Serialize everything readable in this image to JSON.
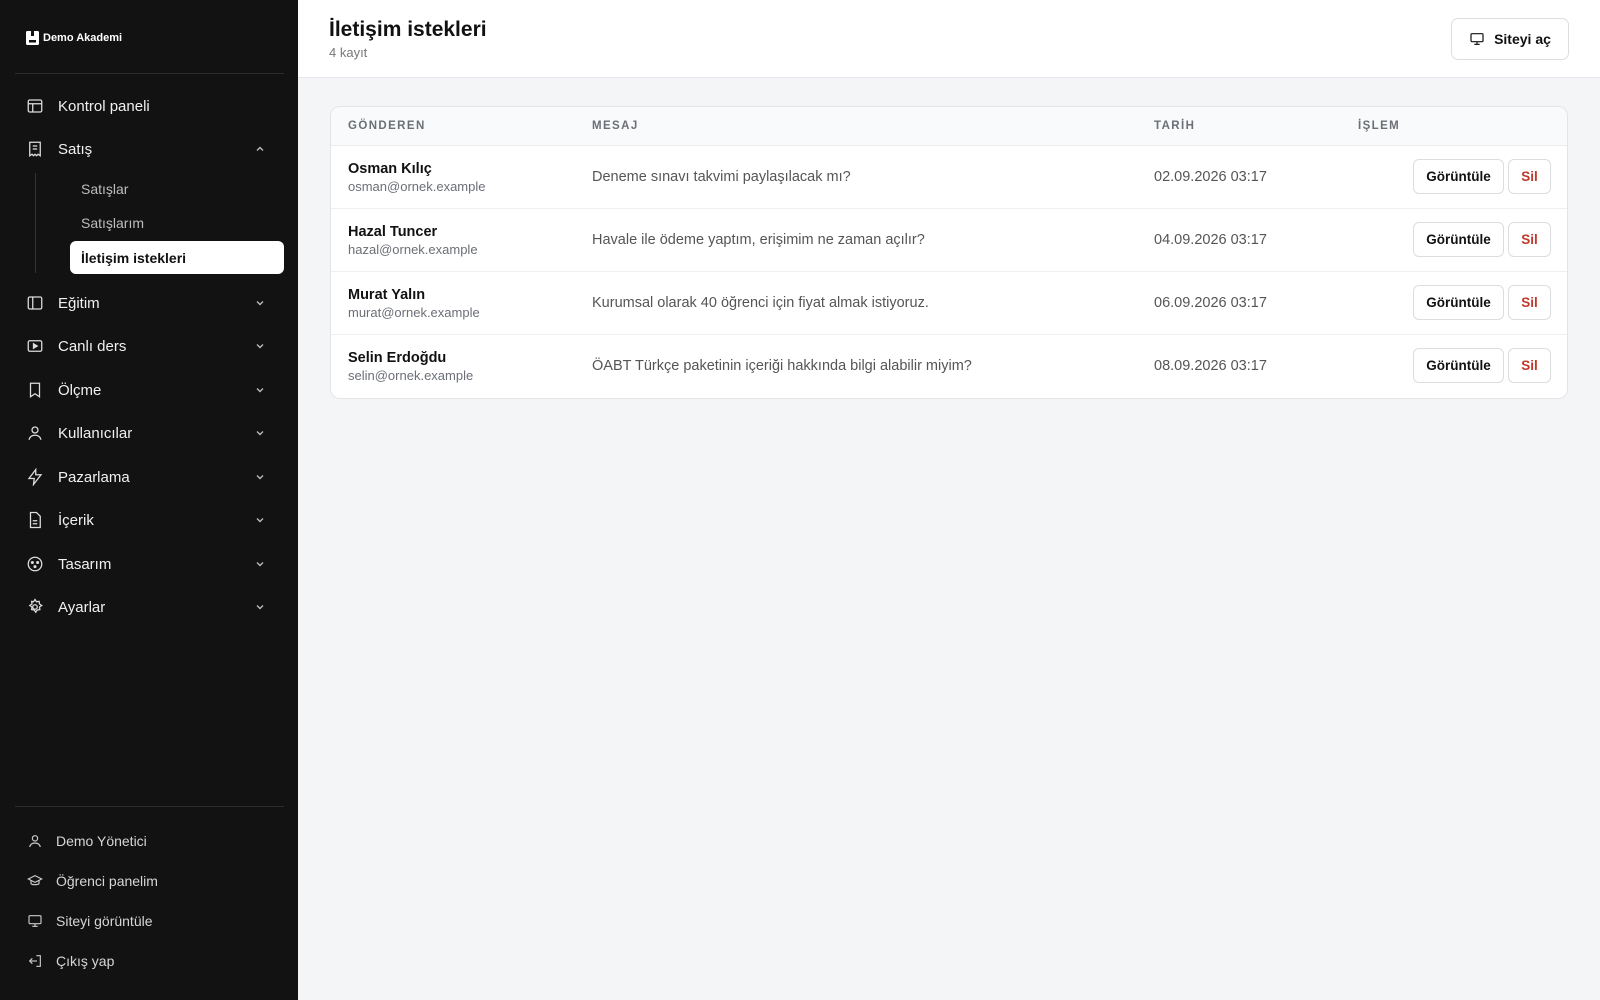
{
  "brand": {
    "name": "Demo Akademi",
    "icon": "brand-logo-icon"
  },
  "sidebar": {
    "items": [
      {
        "label": "Kontrol paneli",
        "icon": "layout-icon"
      },
      {
        "label": "Satış",
        "icon": "receipt-icon",
        "expanded": true
      },
      {
        "label": "Eğitim",
        "icon": "sidebar-book-icon"
      },
      {
        "label": "Canlı ders",
        "icon": "video-play-icon"
      },
      {
        "label": "Ölçme",
        "icon": "bookmark-icon"
      },
      {
        "label": "Kullanıcılar",
        "icon": "user-icon"
      },
      {
        "label": "Pazarlama",
        "icon": "lightning-icon"
      },
      {
        "label": "İçerik",
        "icon": "document-icon"
      },
      {
        "label": "Tasarım",
        "icon": "palette-icon"
      },
      {
        "label": "Ayarlar",
        "icon": "gear-icon"
      }
    ],
    "sales_sub": [
      {
        "label": "Satışlar"
      },
      {
        "label": "Satışlarım"
      },
      {
        "label": "İletişim istekleri",
        "active": true
      }
    ],
    "footer": [
      {
        "label": "Demo Yönetici",
        "icon": "user-icon"
      },
      {
        "label": "Öğrenci panelim",
        "icon": "graduation-cap-icon"
      },
      {
        "label": "Siteyi görüntüle",
        "icon": "monitor-icon"
      },
      {
        "label": "Çıkış yap",
        "icon": "logout-icon"
      }
    ]
  },
  "header": {
    "title": "İletişim istekleri",
    "count": "4 kayıt",
    "open_site_label": "Siteyi aç",
    "open_site_icon": "monitor-icon"
  },
  "table": {
    "columns": [
      "GÖNDEREN",
      "MESAJ",
      "TARİH",
      "İŞLEM"
    ],
    "rows": [
      {
        "name": "Osman Kılıç",
        "email": "osman@ornek.example",
        "message": "Deneme sınavı takvimi paylaşılacak mı?",
        "date": "02.09.2026 03:17",
        "view": "Görüntüle",
        "delete": "Sil"
      },
      {
        "name": "Hazal Tuncer",
        "email": "hazal@ornek.example",
        "message": "Havale ile ödeme yaptım, erişimim ne zaman açılır?",
        "date": "04.09.2026 03:17",
        "view": "Görüntüle",
        "delete": "Sil"
      },
      {
        "name": "Murat Yalın",
        "email": "murat@ornek.example",
        "message": "Kurumsal olarak 40 öğrenci için fiyat almak istiyoruz.",
        "date": "06.09.2026 03:17",
        "view": "Görüntüle",
        "delete": "Sil"
      },
      {
        "name": "Selin Erdoğdu",
        "email": "selin@ornek.example",
        "message": "ÖABT Türkçe paketinin içeriği hakkında bilgi alabilir miyim?",
        "date": "08.09.2026 03:17",
        "view": "Görüntüle",
        "delete": "Sil"
      }
    ]
  },
  "colors": {
    "sidebar_bg": "#121212",
    "page_bg": "#f4f5f7",
    "danger": "#c0392b"
  }
}
